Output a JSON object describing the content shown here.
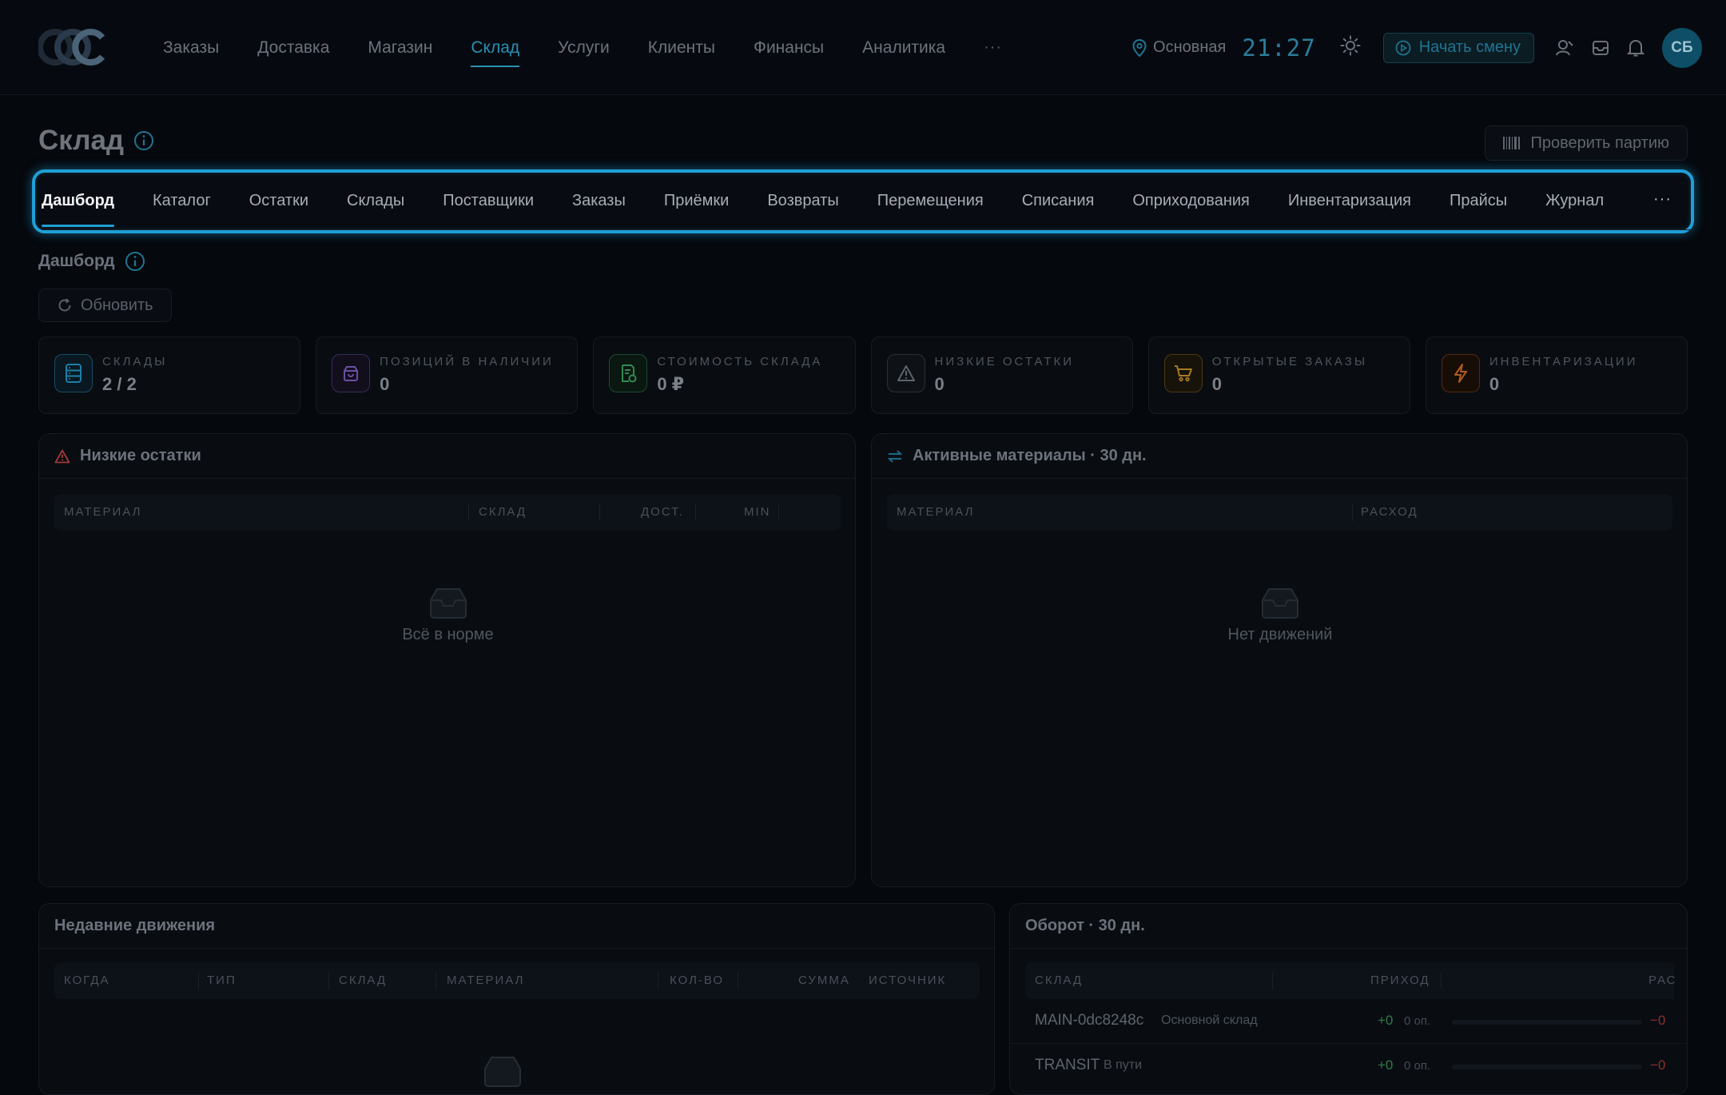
{
  "topbar": {
    "nav": [
      "Заказы",
      "Доставка",
      "Магазин",
      "Склад",
      "Услуги",
      "Клиенты",
      "Финансы",
      "Аналитика"
    ],
    "active_nav": "Склад",
    "more": "···",
    "location": "Основная",
    "clock": "21:27",
    "shift_button": "Начать смену",
    "avatar": "СБ"
  },
  "page": {
    "title": "Склад",
    "check_batch": "Проверить партию",
    "tabs": [
      "Дашборд",
      "Каталог",
      "Остатки",
      "Склады",
      "Поставщики",
      "Заказы",
      "Приёмки",
      "Возвраты",
      "Перемещения",
      "Списания",
      "Оприходования",
      "Инвентаризация",
      "Прайсы",
      "Журнал"
    ],
    "active_tab": "Дашборд",
    "tabs_more": "···",
    "section_title": "Дашборд",
    "refresh": "Обновить"
  },
  "stats": [
    {
      "label": "СКЛАДЫ",
      "value": "2 / 2",
      "color": "#1d7fa8",
      "icon": "warehouse-icon"
    },
    {
      "label": "ПОЗИЦИЙ В НАЛИЧИИ",
      "value": "0",
      "color": "#6b4fa3",
      "icon": "box-icon"
    },
    {
      "label": "СТОИМОСТЬ СКЛАДА",
      "value": "0 ₽",
      "color": "#2f8a52",
      "icon": "receipt-icon"
    },
    {
      "label": "НИЗКИЕ ОСТАТКИ",
      "value": "0",
      "color": "#5d636c",
      "icon": "warning-icon"
    },
    {
      "label": "ОТКРЫТЫЕ ЗАКАЗЫ",
      "value": "0",
      "color": "#a8791f",
      "icon": "cart-icon"
    },
    {
      "label": "ИНВЕНТАРИЗАЦИИ",
      "value": "0",
      "color": "#b05a1f",
      "icon": "bolt-icon"
    }
  ],
  "low_stock": {
    "title": "Низкие остатки",
    "columns": [
      "МАТЕРИАЛ",
      "СКЛАД",
      "ДОСТ.",
      "MIN"
    ],
    "empty": "Всё в норме"
  },
  "active_materials": {
    "title": "Активные материалы · 30 дн.",
    "columns": [
      "МАТЕРИАЛ",
      "РАСХОД"
    ],
    "empty": "Нет движений"
  },
  "recent": {
    "title": "Недавние движения",
    "columns": [
      "КОГДА",
      "ТИП",
      "СКЛАД",
      "МАТЕРИАЛ",
      "КОЛ-ВО",
      "СУММА",
      "ИСТОЧНИК"
    ]
  },
  "turnover": {
    "title": "Оборот · 30 дн.",
    "columns": [
      "СКЛАД",
      "ПРИХОД",
      "РАС"
    ],
    "rows": [
      {
        "code": "MAIN-0dc8248c",
        "name": "Основной склад",
        "in": "+0",
        "ops": "0 оп.",
        "out": "−0"
      },
      {
        "code": "TRANSIT",
        "name": "В пути",
        "in": "+0",
        "ops": "0 оп.",
        "out": "−0"
      }
    ]
  }
}
